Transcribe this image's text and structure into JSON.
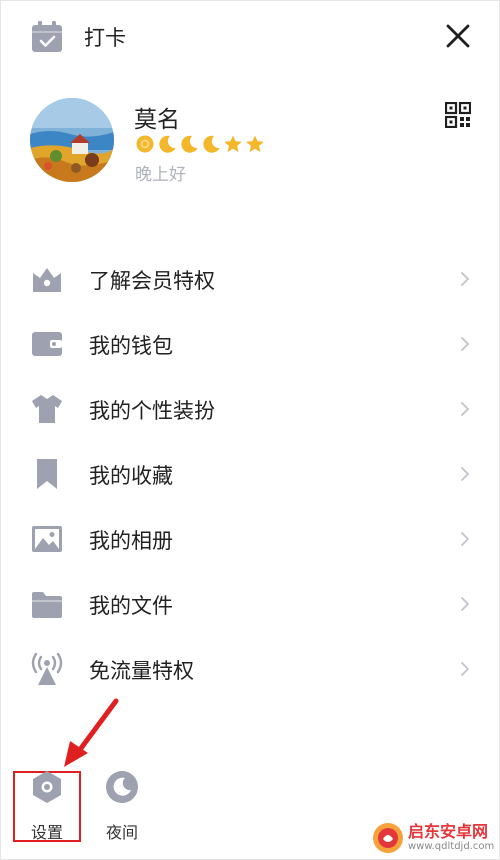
{
  "topbar": {
    "checkin_label": "打卡"
  },
  "profile": {
    "name": "莫名",
    "greeting": "晚上好",
    "level_icons": [
      "sun-icon",
      "moon-icon",
      "moon-icon",
      "moon-icon",
      "star-icon",
      "star-icon"
    ]
  },
  "menu": {
    "items": [
      {
        "label": "了解会员特权",
        "icon": "crown-icon"
      },
      {
        "label": "我的钱包",
        "icon": "wallet-icon"
      },
      {
        "label": "我的个性装扮",
        "icon": "shirt-icon"
      },
      {
        "label": "我的收藏",
        "icon": "bookmark-icon"
      },
      {
        "label": "我的相册",
        "icon": "photo-icon"
      },
      {
        "label": "我的文件",
        "icon": "folder-icon"
      },
      {
        "label": "免流量特权",
        "icon": "antenna-icon"
      }
    ]
  },
  "bottom": {
    "settings_label": "设置",
    "night_label": "夜间"
  },
  "watermark": {
    "title": "启东安卓网",
    "url": "www.qdltdjd.com"
  },
  "colors": {
    "icon_gray": "#9da1b0",
    "chevron": "#c2c4cc",
    "level_gold": "#f5b72a",
    "annotation_red": "#e02020"
  }
}
